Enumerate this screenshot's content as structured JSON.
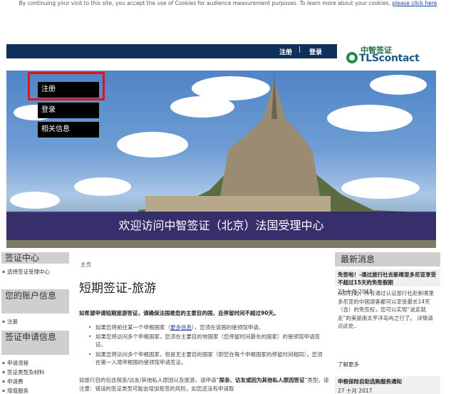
{
  "cookie": {
    "text": "By continuing your visit to this site, you accept the use of Cookies for audience measurement purposes. To learn more about your cookies, ",
    "link": "please click here"
  },
  "topbar": {
    "register": "注册",
    "separator": "|",
    "login": "登录"
  },
  "logo": {
    "cn": "中智签证",
    "en": "TLScontact"
  },
  "hero": {
    "menu": [
      "注册",
      "登录",
      "相关信息"
    ],
    "welcome": "欢迎访问中智签证（北京）法国受理中心"
  },
  "sidebar": {
    "sections": [
      {
        "heading": "签证中心",
        "items": [
          "选择签证受理中心"
        ]
      },
      {
        "heading": "您的账户信息",
        "items": [
          "注册"
        ]
      },
      {
        "heading": "签证申请信息",
        "items": [
          "申请流程",
          "签证类型及材料",
          "申请费",
          "增值服务"
        ]
      }
    ]
  },
  "main": {
    "breadcrumb": "主页",
    "title": "短期签证-旅游",
    "lead": "如希望申请短期旅游签证，请确保法国是您的主要目的国，且停留时间不超过90天。",
    "bullets": [
      {
        "pre": "如果您将前往某一个申根国家（",
        "link": "更多信息",
        "post": "），您须在该国的使领馆申请。"
      },
      {
        "text": "如果您将访问多个申根国家，您须在主要目的地国家（您停留时间最长的国家）的使领馆申请签证。"
      },
      {
        "text": "如果您将访问多个申根国家，但是无主要目的国家（即您在每个申根国家的停留时间相同），您须在第一入境申根国的使领馆申请签证。"
      }
    ],
    "para_pre": "如旅行目的包含探亲/访友/其他私人原因以及旅游，请申请“",
    "para_bold": "探亲、访友或因为其他私人原因签证",
    "para_post": "”类型。请注意：错误的签证类型可能会增加拒签的风险，如您还没有申请取"
  },
  "news": {
    "heading": "最新消息",
    "items": [
      {
        "title": "免签啦！-通过旅行社去新喀里多尼亚享受不超过15天的免签假期",
        "date": "23 十月 2017"
      },
      {
        "title": "申根保险自助选购服务通知",
        "date": "27 十月 2017"
      }
    ],
    "body": "从即日起，所有通过认证旅行社赴新喀里多尼亚的中国游客都可以享受最长14天（含）的免签权，您可以实现“说走就走”的美丽南太平洋岛屿之行了。 详情请点此处..",
    "more": "了解更多"
  }
}
